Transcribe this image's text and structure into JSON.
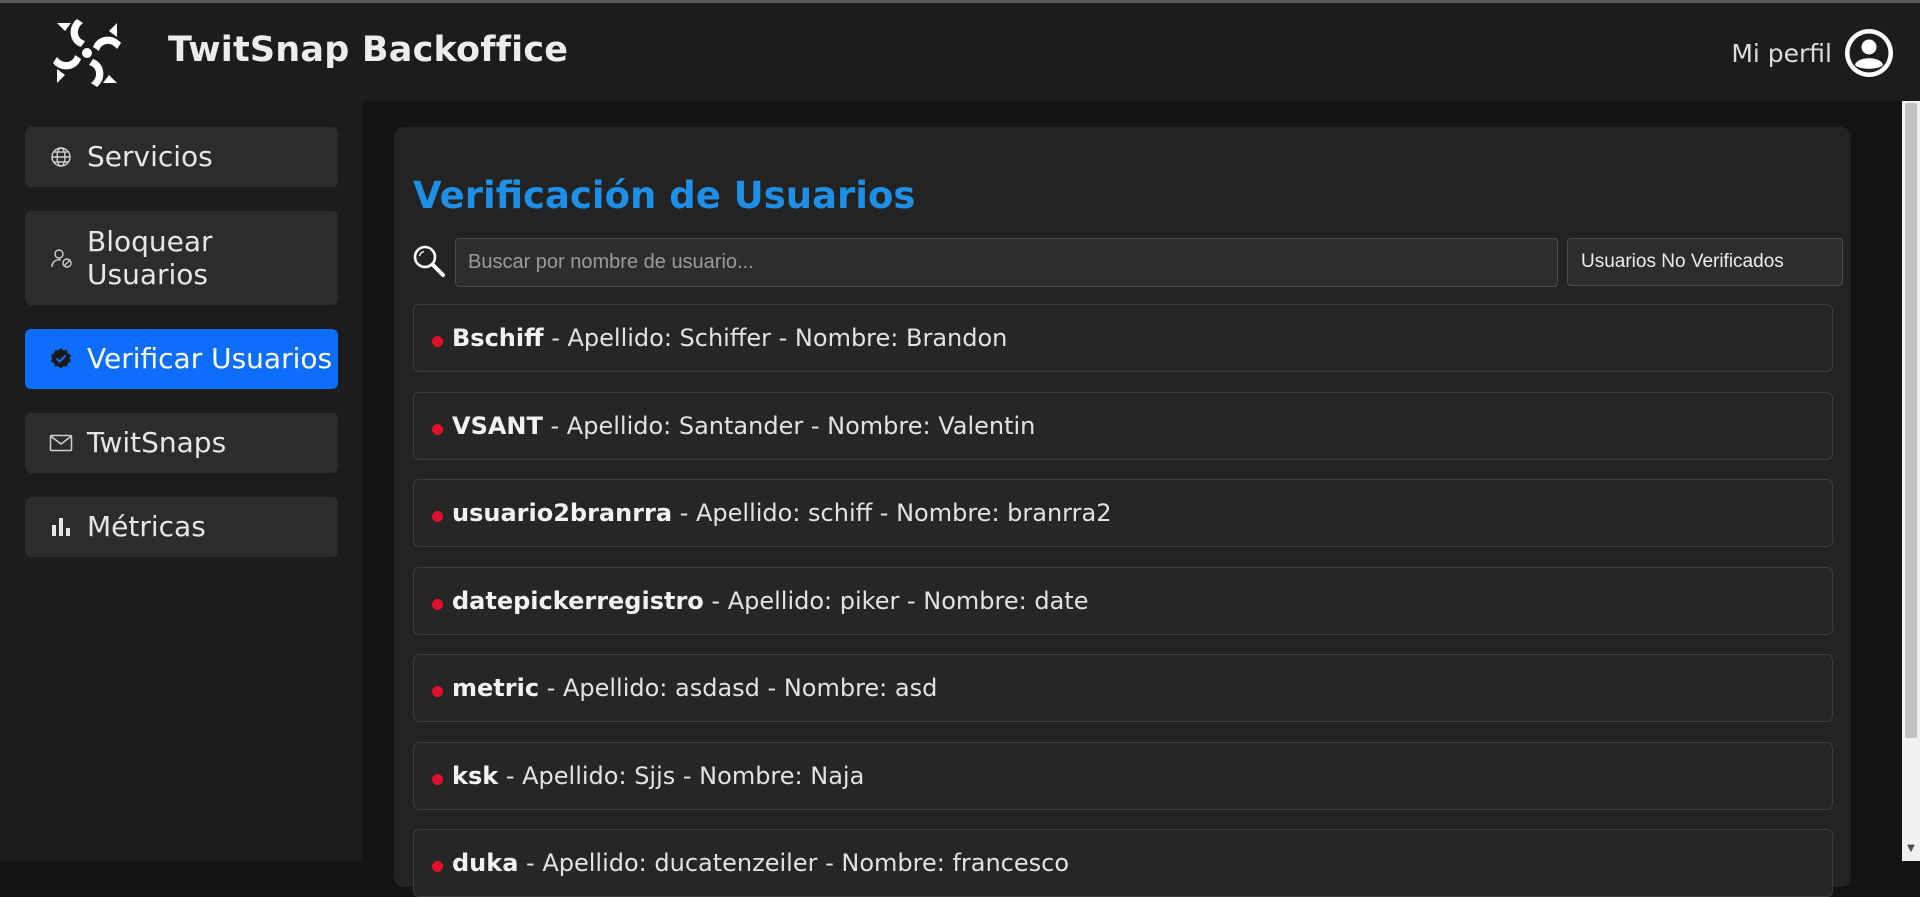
{
  "app": {
    "title": "TwitSnap Backoffice",
    "profile_label": "Mi perfil"
  },
  "icons": {
    "logo": "twitsnap-logo-icon",
    "avatar": "user-circle-icon",
    "search": "magnifier-icon"
  },
  "colors": {
    "accent": "#0d6efd",
    "title": "#1d8fe6",
    "status_unverified": "#e0102a"
  },
  "sidebar": {
    "items": [
      {
        "label": "Servicios",
        "icon": "globe-icon",
        "active": false
      },
      {
        "label_line1": "Bloquear",
        "label_line2": "Usuarios",
        "icon": "user-block-icon",
        "active": false
      },
      {
        "label": "Verificar Usuarios",
        "icon": "verified-badge-icon",
        "active": true
      },
      {
        "label": "TwitSnaps",
        "icon": "envelope-icon",
        "active": false
      },
      {
        "label": "Métricas",
        "icon": "bar-chart-icon",
        "active": false
      }
    ]
  },
  "main": {
    "title": "Verificación de Usuarios",
    "search": {
      "placeholder": "Buscar por nombre de usuario...",
      "value": ""
    },
    "filter": {
      "selected": "Usuarios No Verificados"
    },
    "users": [
      {
        "username": "Bschiff",
        "details": " - Apellido: Schiffer - Nombre: Brandon"
      },
      {
        "username": "VSANT",
        "details": " - Apellido: Santander - Nombre: Valentin"
      },
      {
        "username": "usuario2branrra",
        "details": " - Apellido: schiff - Nombre: branrra2"
      },
      {
        "username": "datepickerregistro",
        "details": " - Apellido: piker - Nombre: date"
      },
      {
        "username": "metric",
        "details": " - Apellido: asdasd - Nombre: asd"
      },
      {
        "username": "ksk",
        "details": " - Apellido: Sjjs - Nombre: Naja"
      },
      {
        "username": "duka",
        "details": " - Apellido: ducatenzeiler - Nombre: francesco"
      }
    ]
  }
}
